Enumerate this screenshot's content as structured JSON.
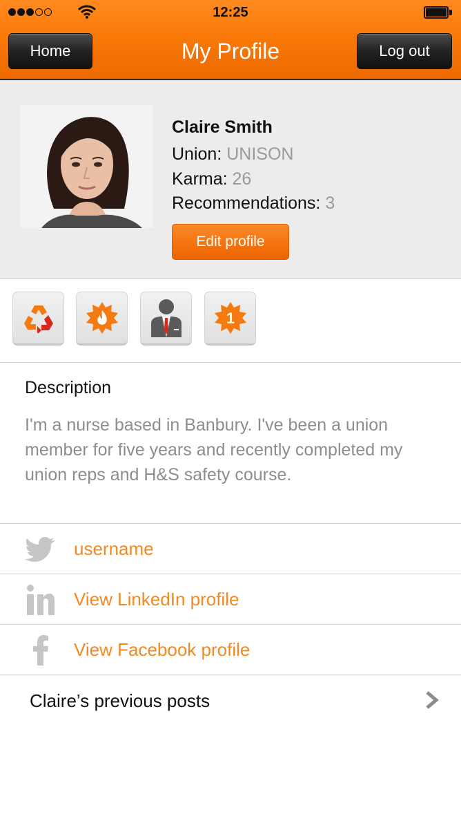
{
  "status_bar": {
    "time": "12:25",
    "signal_filled": 3,
    "signal_total": 5
  },
  "nav": {
    "home_label": "Home",
    "title": "My Profile",
    "logout_label": "Log out"
  },
  "profile": {
    "name": "Claire Smith",
    "union_label": "Union: ",
    "union_value": "UNISON",
    "karma_label": "Karma: ",
    "karma_value": "26",
    "recommendations_label": "Recommendations: ",
    "recommendations_value": "3",
    "edit_label": "Edit profile"
  },
  "badges": [
    {
      "icon": "recycle-icon"
    },
    {
      "icon": "flame-badge-icon"
    },
    {
      "icon": "rep-person-icon"
    },
    {
      "icon": "number-one-badge-icon",
      "text": "1"
    }
  ],
  "description": {
    "heading": "Description",
    "text": "I'm a nurse based in Banbury. I've been a union member for five years and recently completed my union reps and H&S safety course."
  },
  "social": {
    "twitter": "username",
    "linkedin": "View LinkedIn profile",
    "facebook": "View Facebook profile"
  },
  "posts_label": "Claire’s previous posts",
  "colors": {
    "accent": "#f57a0a",
    "link": "#f08a25",
    "muted_text": "#8d8d8d"
  }
}
